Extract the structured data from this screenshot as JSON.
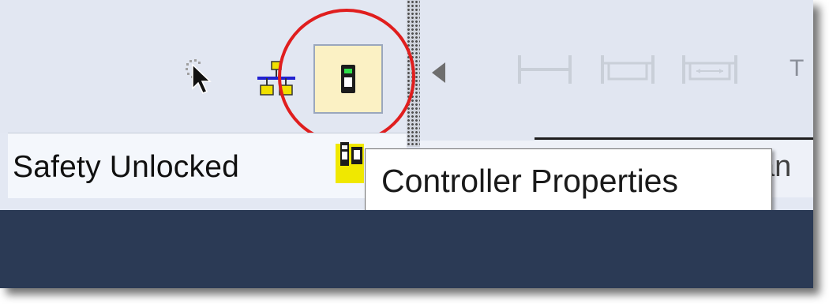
{
  "status": {
    "safety_label": "Safety Unlocked"
  },
  "tooltip": {
    "text": "Controller Properties"
  },
  "toolbar": {
    "partial_label": "T"
  },
  "partial_text_right": "an",
  "icons": {
    "pointer": "select-pointer-icon",
    "network": "network-icon",
    "controller": "controller-properties-icon",
    "collapse": "triangle-left-icon",
    "ladder1": "ladder-rung-icon",
    "ladder2": "ladder-branch-icon",
    "ladder3": "ladder-branch-level-icon",
    "status_controller": "controller-status-icon"
  },
  "colors": {
    "highlight_circle": "#e01e1e",
    "controller_button_bg": "#fbf1c4",
    "bottom_band": "#2b3a55",
    "status_icon_yellow": "#f0e800"
  }
}
